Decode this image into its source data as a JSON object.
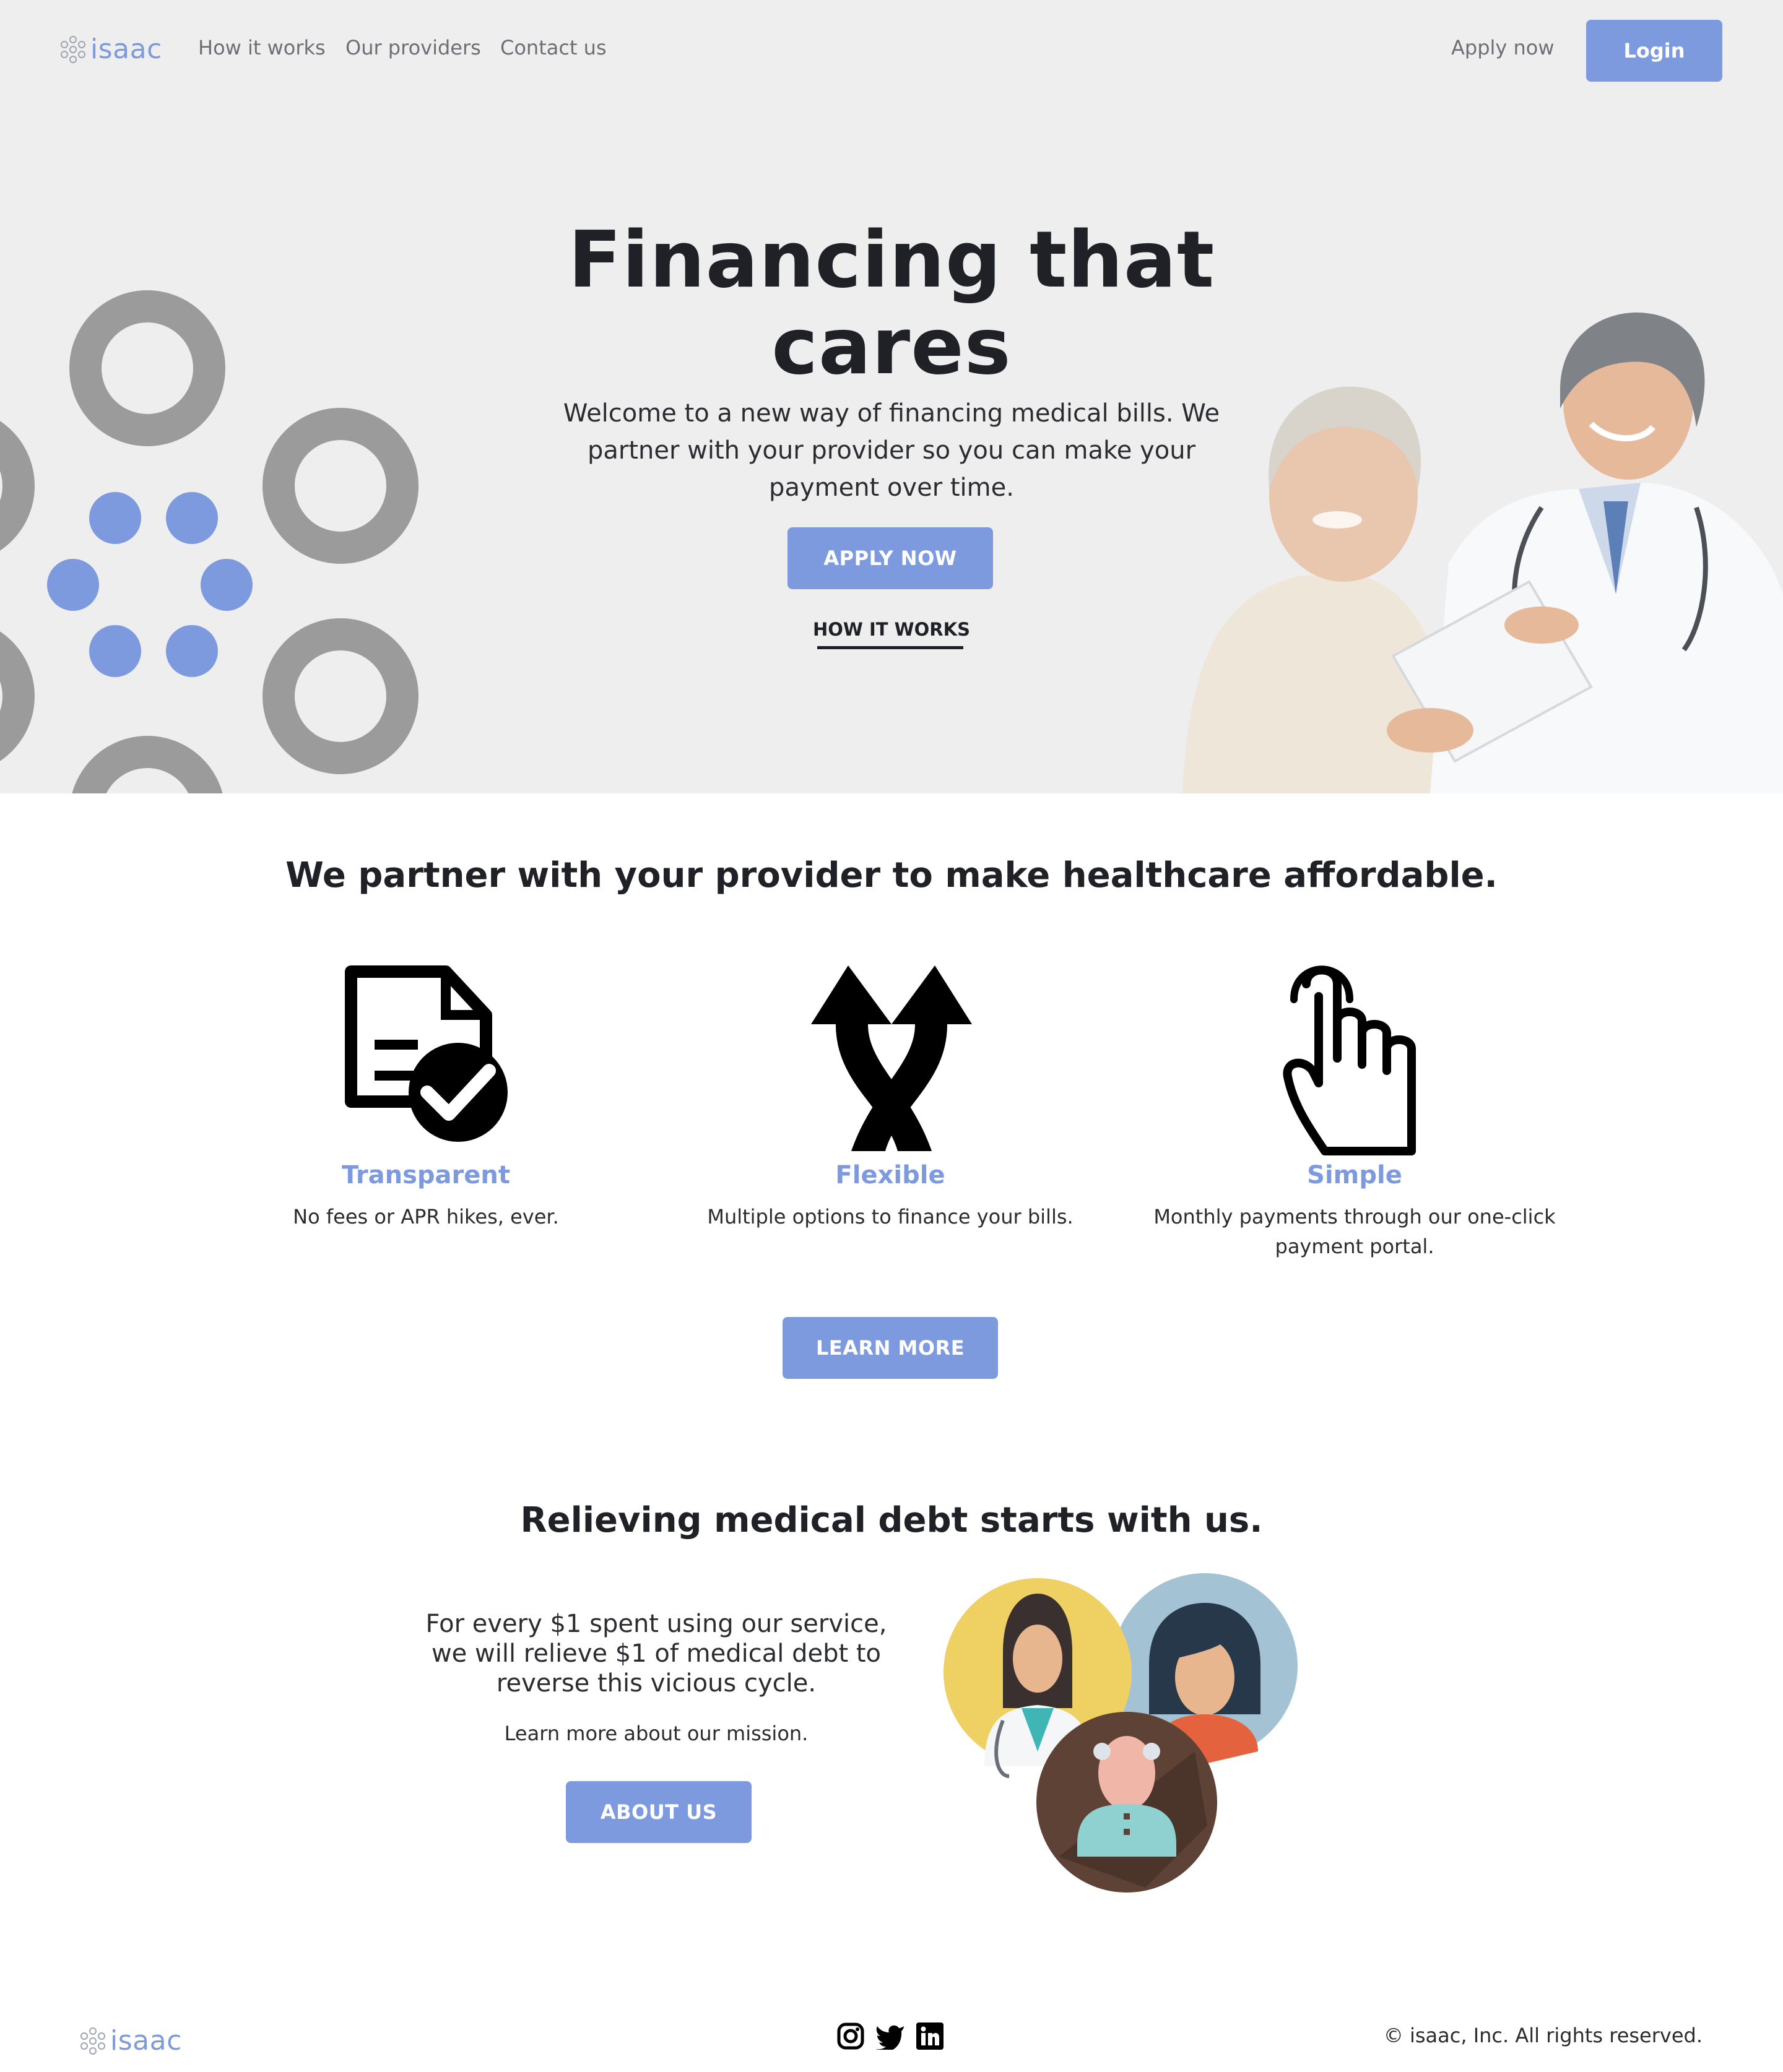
{
  "brand": {
    "name": "isaac",
    "accent_color": "#7d9ade"
  },
  "nav": {
    "links": [
      "How it works",
      "Our providers",
      "Contact us"
    ],
    "apply_label": "Apply now",
    "login_label": "Login"
  },
  "hero": {
    "title": "Financing that cares",
    "subtitle": "Welcome to a new way of financing medical bills. We partner with your provider so you can make your payment over time.",
    "apply_button": "APPLY NOW",
    "how_link": "HOW IT WORKS",
    "image": "doctor-and-patient-photo"
  },
  "features": {
    "title": "We partner with your provider to make healthcare affordable.",
    "items": [
      {
        "icon": "document-check-icon",
        "title": "Transparent",
        "desc": "No fees or APR hikes, ever."
      },
      {
        "icon": "crossing-arrows-icon",
        "title": "Flexible",
        "desc": "Multiple options to finance your bills."
      },
      {
        "icon": "pointing-hand-icon",
        "title": "Simple",
        "desc": "Monthly payments through our one-click payment portal."
      }
    ],
    "button": "LEARN MORE"
  },
  "mission": {
    "title": "Relieving medical debt starts with us.",
    "text": "For every $1 spent using our service, we will relieve $1 of medical debt to reverse this vicious cycle.",
    "link_text": "Learn more about our mission.",
    "button": "ABOUT US",
    "image": "people-avatars-illustration"
  },
  "footer": {
    "social_icons": [
      "instagram-icon",
      "twitter-icon",
      "linkedin-icon"
    ],
    "copyright": "© isaac, Inc. All rights reserved."
  }
}
